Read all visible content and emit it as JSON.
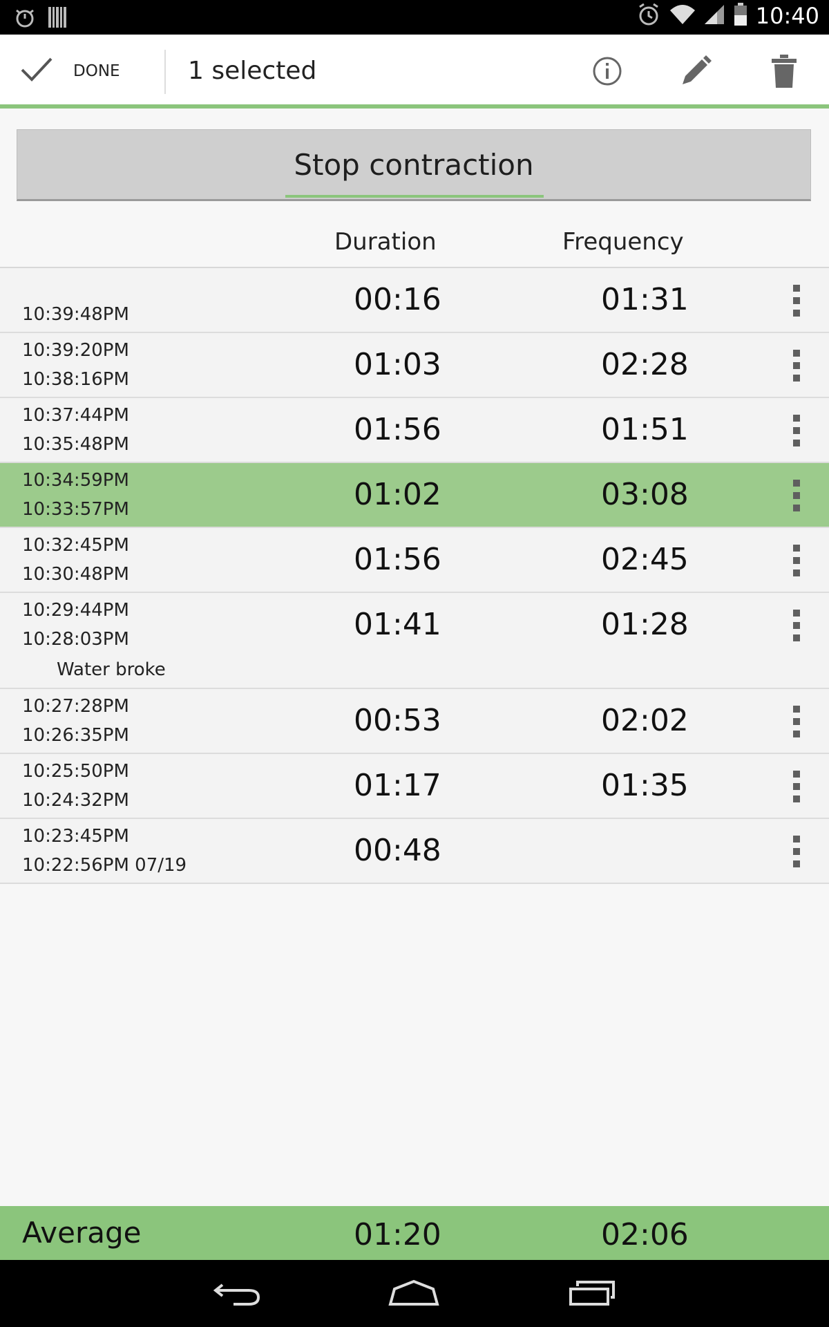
{
  "status_bar": {
    "clock": "10:40",
    "left_icons": [
      "stopwatch-icon",
      "barcode-icon"
    ],
    "right_icons": [
      "alarm-icon",
      "wifi-icon",
      "signal-icon",
      "battery-icon"
    ]
  },
  "action_bar": {
    "done_label": "DONE",
    "title": "1 selected",
    "actions": [
      "info-icon",
      "pencil-icon",
      "trash-icon"
    ],
    "accent_color": "#8bc57c"
  },
  "stop_button": {
    "label": "Stop contraction"
  },
  "columns": {
    "duration": "Duration",
    "frequency": "Frequency"
  },
  "rows": [
    {
      "start": "",
      "end": "10:39:48PM",
      "duration": "00:16",
      "frequency": "01:31",
      "note": "",
      "selected": false
    },
    {
      "start": "10:39:20PM",
      "end": "10:38:16PM",
      "duration": "01:03",
      "frequency": "02:28",
      "note": "",
      "selected": false
    },
    {
      "start": "10:37:44PM",
      "end": "10:35:48PM",
      "duration": "01:56",
      "frequency": "01:51",
      "note": "",
      "selected": false
    },
    {
      "start": "10:34:59PM",
      "end": "10:33:57PM",
      "duration": "01:02",
      "frequency": "03:08",
      "note": "",
      "selected": true
    },
    {
      "start": "10:32:45PM",
      "end": "10:30:48PM",
      "duration": "01:56",
      "frequency": "02:45",
      "note": "",
      "selected": false
    },
    {
      "start": "10:29:44PM",
      "end": "10:28:03PM",
      "duration": "01:41",
      "frequency": "01:28",
      "note": "Water broke",
      "selected": false
    },
    {
      "start": "10:27:28PM",
      "end": "10:26:35PM",
      "duration": "00:53",
      "frequency": "02:02",
      "note": "",
      "selected": false
    },
    {
      "start": "10:25:50PM",
      "end": "10:24:32PM",
      "duration": "01:17",
      "frequency": "01:35",
      "note": "",
      "selected": false
    },
    {
      "start": "10:23:45PM",
      "end": "10:22:56PM 07/19",
      "duration": "00:48",
      "frequency": "",
      "note": "",
      "selected": false
    }
  ],
  "average": {
    "label": "Average",
    "duration": "01:20",
    "frequency": "02:06"
  },
  "nav_bar": {
    "buttons": [
      "back-icon",
      "home-icon",
      "recents-icon"
    ]
  }
}
